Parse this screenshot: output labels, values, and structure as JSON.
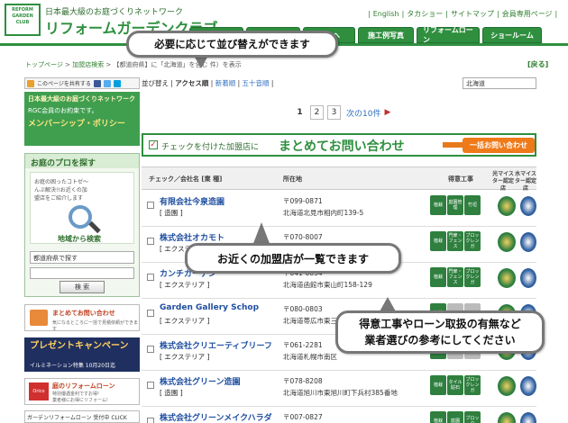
{
  "header": {
    "logo_text": "REFORM GARDEN CLUB",
    "tagline": "日本最大級のお庭づくりネットワーク",
    "site_name": "リフォームガーデンクラブ",
    "top_links": [
      "English",
      "タカショー",
      "サイトマップ",
      "会員専用ページ"
    ],
    "nav_tabs": [
      "",
      "",
      "の方へ",
      "施工例写真",
      "リフォームローン",
      "ショールーム"
    ]
  },
  "breadcrumb": {
    "home": "トップページ",
    "search": "加盟店検索",
    "condition": "【都道府県】に「北海道」を含む",
    "suffix": "件）を表示",
    "back": "[戻る]"
  },
  "sidebar": {
    "share_label": "このページを共有する",
    "rgc_banner": {
      "line1": "日本最大級のお庭づくりネットワーク",
      "line2": "RGC会員のお約束です。",
      "line3": "メンバーシップ・ポリシー"
    },
    "find_title": "お庭のプロを探す",
    "find_text": "お庭の困ったコトゼ～んぶ解決!!お近くの加盟店をご紹介します",
    "region_button": "地域から検索",
    "pref_placeholder": "都道府県で探す",
    "search_button": "検 索",
    "bulk_banner": {
      "title": "まとめてお問い合わせ",
      "sub": "気になるところに一括で見積依頼ができます"
    },
    "present_banner": {
      "title": "プレゼントキャンペーン",
      "sub": "イルミネーション特集 10月20日迄"
    },
    "loan_banner": {
      "logo": "Orico",
      "title": "庭のリフォームローン",
      "sub": "特別優遇金利ですお得!\n業者様にお得にリフォーム!"
    },
    "gw_banner": "ガーデンリフォームローン 受付中 CLICK"
  },
  "main": {
    "sort_label": "並び替え",
    "sort_options": [
      "アクセス順",
      "新着順",
      "五十音順"
    ],
    "area_select": "北海道",
    "pager": {
      "pages": [
        "1",
        "2",
        "3"
      ],
      "next": "次の10件"
    },
    "inquiry": {
      "check_text": "チェックを付けた加盟店に",
      "big_text": "まとめてお問い合わせ",
      "button": "一括お問い合わせ"
    },
    "table_head": {
      "name": "チェック／会社名 [業 種]",
      "address": "所在地",
      "specialty": "得意工事",
      "light": "光マイスター認定店",
      "water": "水マイスター認定店"
    },
    "rows": [
      {
        "name": "有限会社今泉造園",
        "category": "[ 造園 ]",
        "zip": "〒099-0871",
        "address": "北海道北見市相内町139-5",
        "specs": [
          "植栽",
          "庭園管理",
          "竹垣"
        ]
      },
      {
        "name": "株式会社オカモト",
        "category": "[ エクステリア ]",
        "zip": "〒070-8007",
        "address": "",
        "specs": [
          "植栽",
          "門扉・フェンス",
          "ブロックレンガ"
        ]
      },
      {
        "name": "カンチガーデン",
        "category": "[ エクステリア ]",
        "zip": "〒041-0854",
        "address": "北海道函館市東山町158-129",
        "specs": [
          "植栽",
          "門扉・フェンス",
          "ブロックレンガ"
        ]
      },
      {
        "name": "Garden Gallery Schop",
        "category": "[ エクステリア ]",
        "zip": "〒080-0803",
        "address": "北海道帯広市東三条",
        "specs": [
          "植栽",
          "",
          ""
        ]
      },
      {
        "name": "株式会社クリエーティブリーフ",
        "category": "[ エクステリア ]",
        "zip": "〒061-2281",
        "address": "北海道札幌市南区",
        "specs": [
          "植栽",
          "",
          ""
        ]
      },
      {
        "name": "株式会社グリーン造園",
        "category": "[ 造園 ]",
        "zip": "〒078-8208",
        "address": "北海道旭川市東旭川町下兵村385番地",
        "specs": [
          "植栽",
          "タイル貼石",
          "ブロックレンガ"
        ]
      },
      {
        "name": "株式会社グリーンメイクハラダ",
        "category": "",
        "zip": "〒007-0827",
        "address": "",
        "specs": [
          "植栽",
          "庭園",
          "ブロック"
        ]
      }
    ]
  },
  "callouts": {
    "sort": "必要に応じて並び替えができます",
    "list": "お近くの加盟店が一覧できます",
    "hint_line1": "得意工事やローン取扱の有無など",
    "hint_line2": "業者選びの参考にしてください"
  },
  "colors": {
    "brand_green": "#2f8f3f",
    "accent_orange": "#ef7a1a",
    "link_blue": "#1f4fa0"
  }
}
